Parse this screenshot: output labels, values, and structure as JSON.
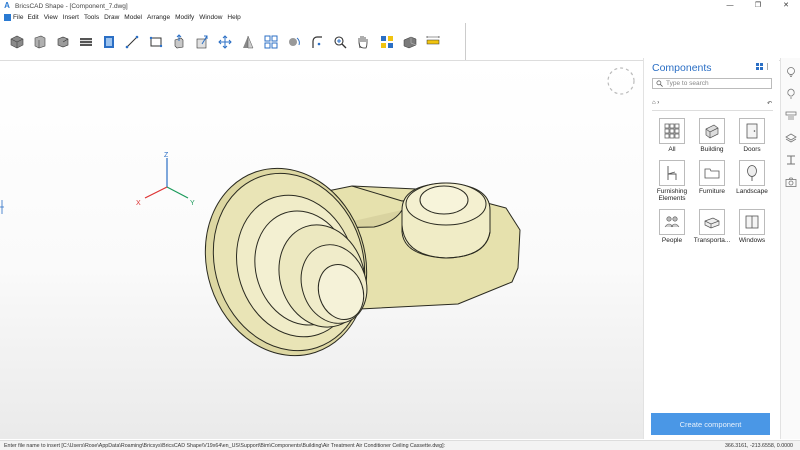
{
  "app": {
    "title": "BricsCAD Shape - [Component_7.dwg]",
    "icon": "A"
  },
  "window_controls": [
    "—",
    "❐",
    "✕"
  ],
  "menu": [
    "File",
    "Edit",
    "View",
    "Insert",
    "Tools",
    "Draw",
    "Model",
    "Arrange",
    "Modify",
    "Window",
    "Help"
  ],
  "toolbar": {
    "tools": [
      {
        "name": "solid-box-tool-icon"
      },
      {
        "name": "cylinder-tool-icon"
      },
      {
        "name": "box-tool-icon"
      },
      {
        "name": "wall-tool-icon"
      },
      {
        "name": "slab-tool-icon"
      },
      {
        "name": "line-tool-icon"
      },
      {
        "name": "rectangle-tool-icon"
      },
      {
        "name": "push-pull-tool-icon"
      },
      {
        "name": "extrude-tool-icon"
      },
      {
        "name": "move-tool-icon"
      },
      {
        "name": "mirror-tool-icon"
      },
      {
        "name": "array-tool-icon"
      },
      {
        "name": "rotate-tool-icon"
      },
      {
        "name": "fillet-tool-icon"
      },
      {
        "name": "zoom-tool-icon"
      },
      {
        "name": "pan-tool-icon"
      },
      {
        "name": "select-tool-icon"
      },
      {
        "name": "render-tool-icon"
      },
      {
        "name": "measure-tool-icon"
      }
    ]
  },
  "viewport": {
    "axis_labels": {
      "x": "X",
      "y": "Y",
      "z": "Z"
    },
    "model_color": "#eeeac0"
  },
  "components_panel": {
    "title": "Components",
    "search_placeholder": "Type to search",
    "breadcrumb_home": "⌂",
    "breadcrumb_sep": "›",
    "back": "↶",
    "items": [
      {
        "label": "All",
        "icon": "grid-icon"
      },
      {
        "label": "Building",
        "icon": "building-icon"
      },
      {
        "label": "Doors",
        "icon": "door-icon"
      },
      {
        "label": "Furnishing Elements",
        "icon": "chair-icon"
      },
      {
        "label": "Furniture",
        "icon": "folder-icon"
      },
      {
        "label": "Landscape",
        "icon": "tree-icon"
      },
      {
        "label": "People",
        "icon": "people-icon"
      },
      {
        "label": "Transporta...",
        "icon": "transport-icon"
      },
      {
        "label": "Windows",
        "icon": "window-icon"
      }
    ],
    "create_button": "Create component"
  },
  "right_rail": [
    "lightbulb-icon",
    "bulb-outline-icon",
    "properties-icon",
    "layers-icon",
    "beam-icon",
    "camera-icon"
  ],
  "status": {
    "prompt": "Enter file name to insert [C:\\Users\\Rose\\AppData\\Roaming\\Bricsys\\BricsCAD Shape\\V19x64\\en_US\\Support\\Bim\\Components\\Building\\Air Treatment Air Conditioner Ceiling Cassette.dwg]:",
    "coords": "366.3161, -213.6558, 0.0000"
  },
  "colors": {
    "accent": "#2b6fc5",
    "button": "#4a97e6"
  }
}
